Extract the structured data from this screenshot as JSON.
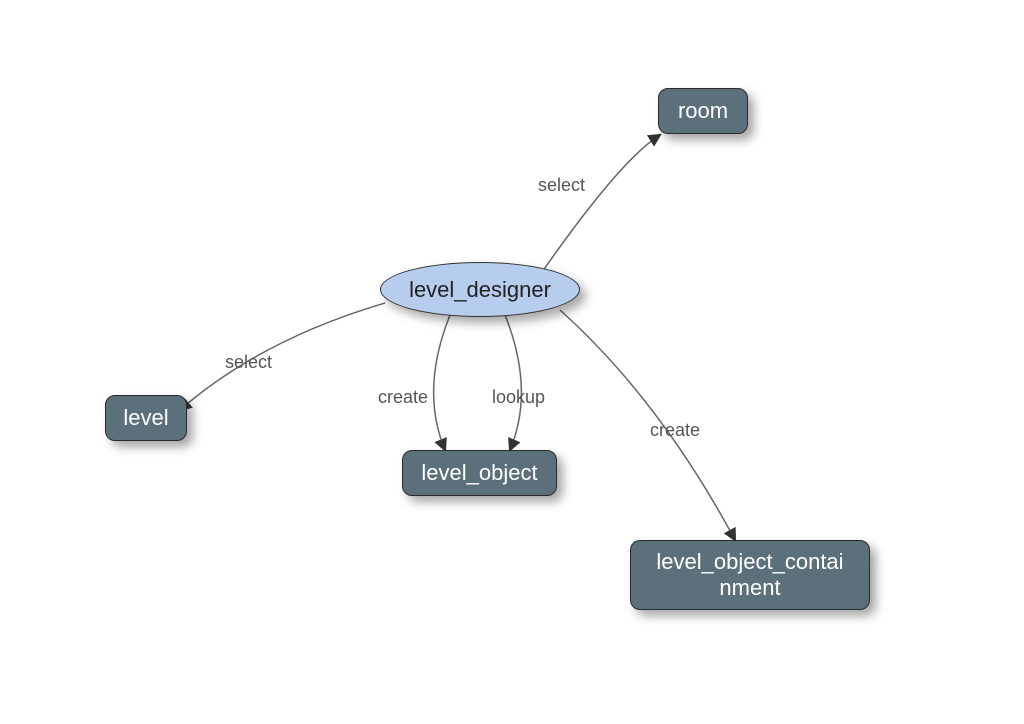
{
  "diagram": {
    "center_node": {
      "label": "level_designer"
    },
    "nodes": {
      "room": {
        "label": "room"
      },
      "level": {
        "label": "level"
      },
      "level_object": {
        "label": "level_object"
      },
      "level_object_containment": {
        "label": "level_object_contai\nnment"
      }
    },
    "edges": {
      "to_room": {
        "label": "select"
      },
      "to_level": {
        "label": "select"
      },
      "to_level_object_create": {
        "label": "create"
      },
      "to_level_object_lookup": {
        "label": "lookup"
      },
      "to_containment": {
        "label": "create"
      }
    }
  },
  "chart_data": {
    "type": "diagram",
    "nodes": [
      {
        "id": "level_designer",
        "label": "level_designer",
        "shape": "ellipse",
        "fill": "#b7cdee"
      },
      {
        "id": "room",
        "label": "room",
        "shape": "roundrect",
        "fill": "#5c707c"
      },
      {
        "id": "level",
        "label": "level",
        "shape": "roundrect",
        "fill": "#5c707c"
      },
      {
        "id": "level_object",
        "label": "level_object",
        "shape": "roundrect",
        "fill": "#5c707c"
      },
      {
        "id": "level_object_containment",
        "label": "level_object_containment",
        "shape": "roundrect",
        "fill": "#5c707c"
      }
    ],
    "edges": [
      {
        "from": "level_designer",
        "to": "room",
        "label": "select"
      },
      {
        "from": "level_designer",
        "to": "level",
        "label": "select"
      },
      {
        "from": "level_designer",
        "to": "level_object",
        "label": "create"
      },
      {
        "from": "level_designer",
        "to": "level_object",
        "label": "lookup"
      },
      {
        "from": "level_designer",
        "to": "level_object_containment",
        "label": "create"
      }
    ]
  }
}
